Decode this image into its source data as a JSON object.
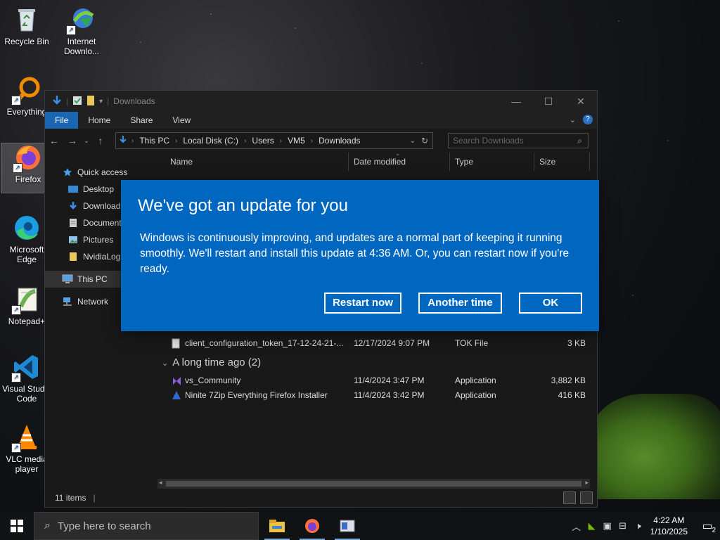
{
  "desktop": {
    "icons": [
      {
        "label": "Recycle Bin"
      },
      {
        "label": "Internet Downlo..."
      },
      {
        "label": "Everything"
      },
      {
        "label": "Firefox"
      },
      {
        "label": "Microsoft Edge"
      },
      {
        "label": "Notepad+"
      },
      {
        "label": "Visual Studio Code"
      },
      {
        "label": "VLC media player"
      }
    ]
  },
  "explorer": {
    "title": "Downloads",
    "ribbon_tabs": [
      "File",
      "Home",
      "Share",
      "View"
    ],
    "breadcrumb": [
      "This PC",
      "Local Disk (C:)",
      "Users",
      "VM5",
      "Downloads"
    ],
    "search_placeholder": "Search Downloads",
    "nav": {
      "quick_access": "Quick access",
      "items": [
        "Desktop",
        "Download",
        "Document",
        "Pictures",
        "NvidiaLog"
      ],
      "this_pc": "This PC",
      "network": "Network"
    },
    "columns": {
      "name": "Name",
      "date": "Date modified",
      "type": "Type",
      "size": "Size"
    },
    "rows_top": [
      {
        "name": "client_configuration_token_17-12-24-21-...",
        "date": "12/17/2024 9:07 PM",
        "type": "TOK File",
        "size": "3 KB"
      }
    ],
    "group_label": "A long time ago (2)",
    "rows_group": [
      {
        "name": "vs_Community",
        "date": "11/4/2024 3:47 PM",
        "type": "Application",
        "size": "3,882 KB"
      },
      {
        "name": "Ninite 7Zip Everything Firefox Installer",
        "date": "11/4/2024 3:42 PM",
        "type": "Application",
        "size": "416 KB"
      }
    ],
    "status": "11 items"
  },
  "update_dialog": {
    "title": "We've got an update for you",
    "body": "Windows is continuously improving, and updates are a normal part of keeping it running smoothly. We'll restart and install this update at 4:36 AM. Or, you can restart now if you're ready.",
    "restart_label": "Restart now",
    "another_label": "Another time",
    "ok_label": "OK",
    "bg_color": "#0067c0"
  },
  "taskbar": {
    "search_placeholder": "Type here to search",
    "time": "4:22 AM",
    "date": "1/10/2025",
    "notification_count": "2"
  }
}
